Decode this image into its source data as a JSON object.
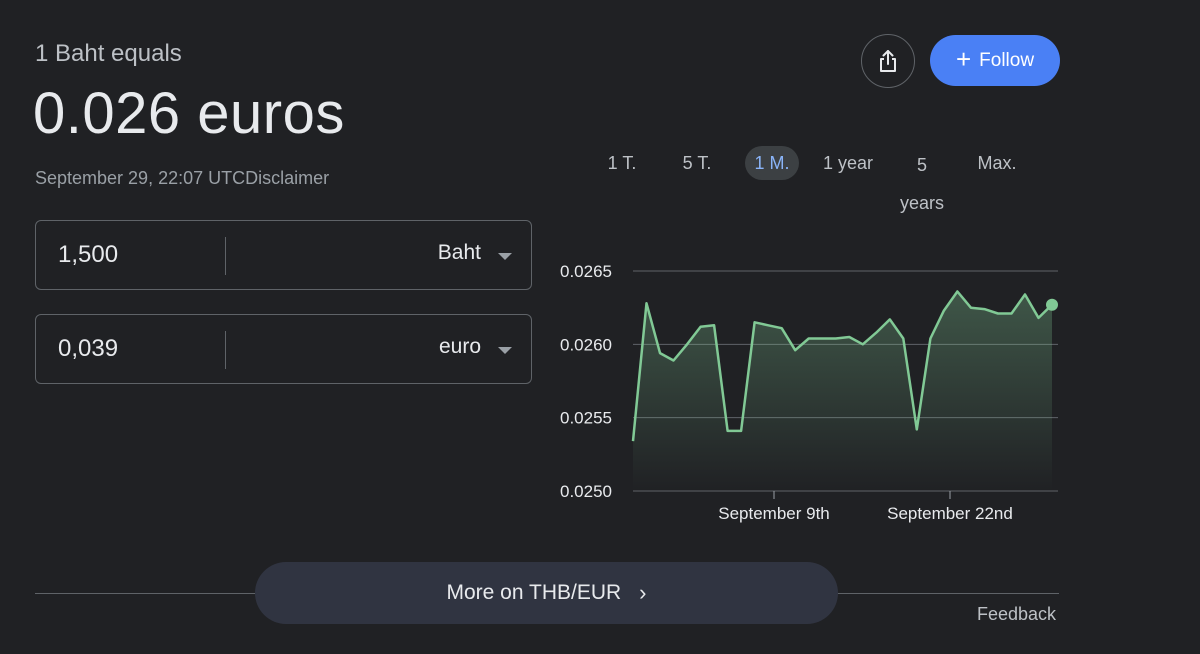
{
  "header": {
    "equals_label": "1 Baht equals",
    "rate_headline": "0.026 euros",
    "timestamp": "September 29, 22:07 UTC",
    "disclaimer": "Disclaimer"
  },
  "converter": {
    "from": {
      "amount": "1,500",
      "currency": "Baht"
    },
    "to": {
      "amount": "0,039",
      "currency": "euro"
    }
  },
  "actions": {
    "share_icon": "share-icon",
    "follow_label": "Follow"
  },
  "range_tabs": [
    "1 T.",
    "5 T.",
    "1 M.",
    "1 year",
    "5",
    "years",
    "Max."
  ],
  "active_range": "1 M.",
  "chart_data": {
    "type": "area",
    "y_ticks": [
      "0.0265",
      "0.0260",
      "0.0255",
      "0.0250"
    ],
    "ylim": [
      0.025,
      0.0265
    ],
    "x_ticks": [
      "September 9th",
      "September 22nd"
    ],
    "line_color": "#81c995",
    "x": [
      0,
      1,
      2,
      3,
      4,
      5,
      6,
      7,
      8,
      9,
      10,
      11,
      12,
      13,
      14,
      15,
      16,
      17,
      18,
      19,
      20,
      21,
      22,
      23,
      24,
      25,
      26,
      27,
      28,
      29
    ],
    "values": [
      0.02534,
      0.02628,
      0.02594,
      0.02589,
      0.026,
      0.02612,
      0.02613,
      0.02541,
      0.02541,
      0.02615,
      0.02613,
      0.02611,
      0.02596,
      0.02604,
      0.02604,
      0.02604,
      0.02605,
      0.026,
      0.02608,
      0.02617,
      0.02604,
      0.02542,
      0.02604,
      0.02623,
      0.02636,
      0.02625,
      0.02624,
      0.02621,
      0.02621,
      0.02634,
      0.02618,
      0.02627
    ]
  },
  "footer": {
    "more_label": "More on THB/EUR",
    "feedback_label": "Feedback"
  }
}
